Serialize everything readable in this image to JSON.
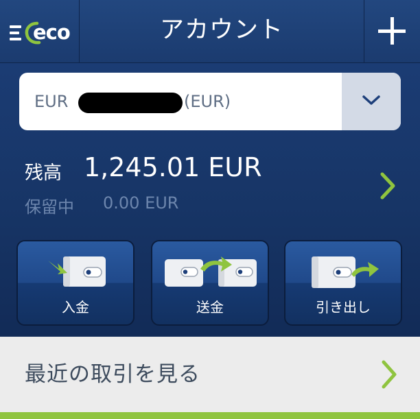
{
  "header": {
    "title": "アカウント",
    "logo_text": "eco",
    "icons": {
      "menu": "hamburger-menu-icon",
      "add": "plus-icon"
    }
  },
  "account_selector": {
    "prefix": "EUR",
    "suffix": "(EUR)",
    "dropdown_icon": "chevron-down-icon"
  },
  "balance": {
    "label": "残高",
    "value": "1,245.01 EUR",
    "hold_label": "保留中",
    "hold_value": "0.00 EUR"
  },
  "actions": [
    {
      "label": "入金",
      "icon": "deposit-wallet-icon"
    },
    {
      "label": "送金",
      "icon": "transfer-wallet-icon"
    },
    {
      "label": "引き出し",
      "icon": "withdraw-wallet-icon"
    }
  ],
  "recent": {
    "label": "最近の取引を見る"
  },
  "colors": {
    "brand_blue": "#1b3b6f",
    "accent_green": "#8fc43f",
    "muted_text": "#6d86ad"
  }
}
